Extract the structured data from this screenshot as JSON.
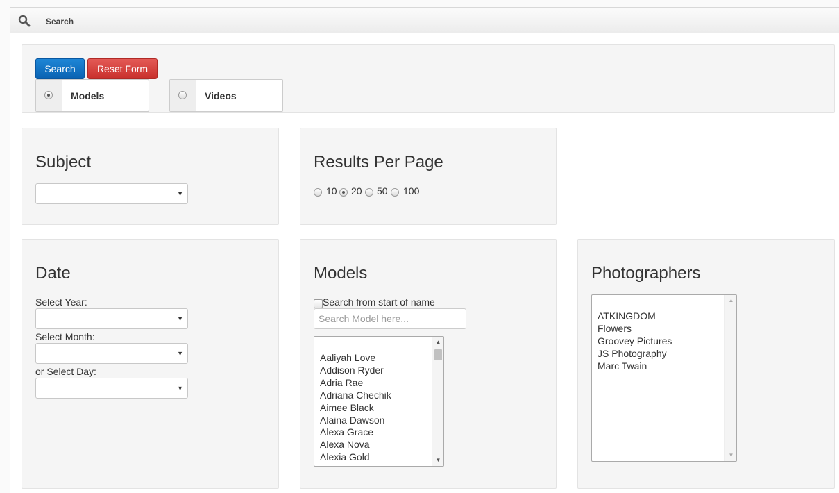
{
  "window": {
    "title": "Search",
    "icon": "search-icon"
  },
  "actions": {
    "search_label": "Search",
    "reset_label": "Reset Form"
  },
  "search_type": {
    "options": [
      {
        "label": "Models",
        "checked": true
      },
      {
        "label": "Videos",
        "checked": false
      }
    ]
  },
  "subject": {
    "heading": "Subject",
    "selected": ""
  },
  "results_per_page": {
    "heading": "Results Per Page",
    "options": [
      {
        "label": "10",
        "checked": false
      },
      {
        "label": "20",
        "checked": true
      },
      {
        "label": "50",
        "checked": false
      },
      {
        "label": "100",
        "checked": false
      }
    ]
  },
  "date": {
    "heading": "Date",
    "year_label": "Select Year:",
    "month_label": "Select Month:",
    "day_label": "or Select Day:"
  },
  "models": {
    "heading": "Models",
    "start_of_name_label": "Search from start of name",
    "search_placeholder": "Search Model here...",
    "list": [
      "Aaliyah Love",
      "Addison Ryder",
      "Adria Rae",
      "Adriana Chechik",
      "Aimee Black",
      "Alaina Dawson",
      "Alexa Grace",
      "Alexa Nova",
      "Alexia Gold"
    ]
  },
  "photographers": {
    "heading": "Photographers",
    "list": [
      "ATKINGDOM",
      "Flowers",
      "Groovey Pictures",
      "JS Photography",
      "Marc Twain"
    ]
  },
  "colors": {
    "primary_button": "#0a62b2",
    "danger_button": "#c9302c",
    "panel_background": "#f5f5f5"
  }
}
